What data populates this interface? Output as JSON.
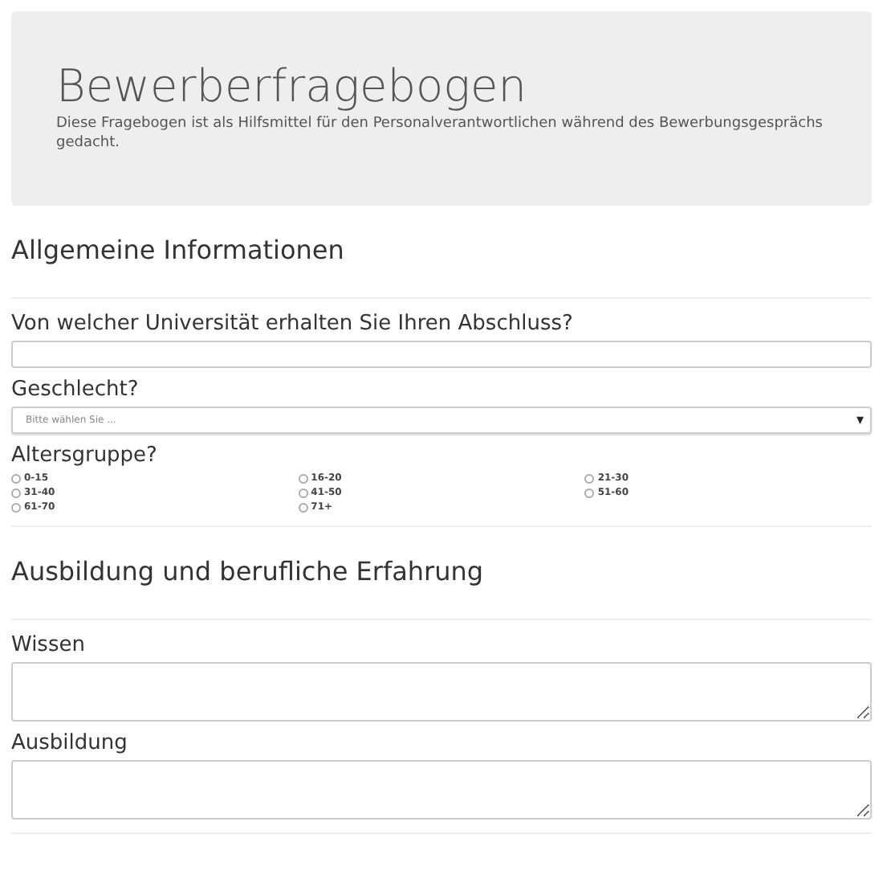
{
  "header": {
    "title": "Bewerberfragebogen",
    "description": "Diese Fragebogen ist als Hilfsmittel für den Personalverantwortlichen während des Bewerbungsgesprächs gedacht."
  },
  "sections": [
    {
      "title": "Allgemeine Informationen",
      "fields": [
        {
          "kind": "text",
          "label": "Von welcher Universität erhalten Sie Ihren Abschluss?"
        },
        {
          "kind": "select",
          "label": "Geschlecht?",
          "placeholder": "Bitte wählen Sie ...",
          "arrow": "▾"
        },
        {
          "kind": "radio",
          "label": "Altersgruppe?",
          "options": [
            {
              "label": "0-15",
              "selected": false
            },
            {
              "label": "16-20",
              "selected": false
            },
            {
              "label": "21-30",
              "selected": false
            },
            {
              "label": "31-40",
              "selected": false
            },
            {
              "label": "41-50",
              "selected": false
            },
            {
              "label": "51-60",
              "selected": false
            },
            {
              "label": "61-70",
              "selected": false
            },
            {
              "label": "71+",
              "selected": false
            }
          ]
        }
      ]
    },
    {
      "title": "Ausbildung und berufliche Erfahrung",
      "fields": [
        {
          "kind": "textarea",
          "label": "Wissen"
        },
        {
          "kind": "textarea",
          "label": "Ausbildung"
        }
      ]
    }
  ]
}
